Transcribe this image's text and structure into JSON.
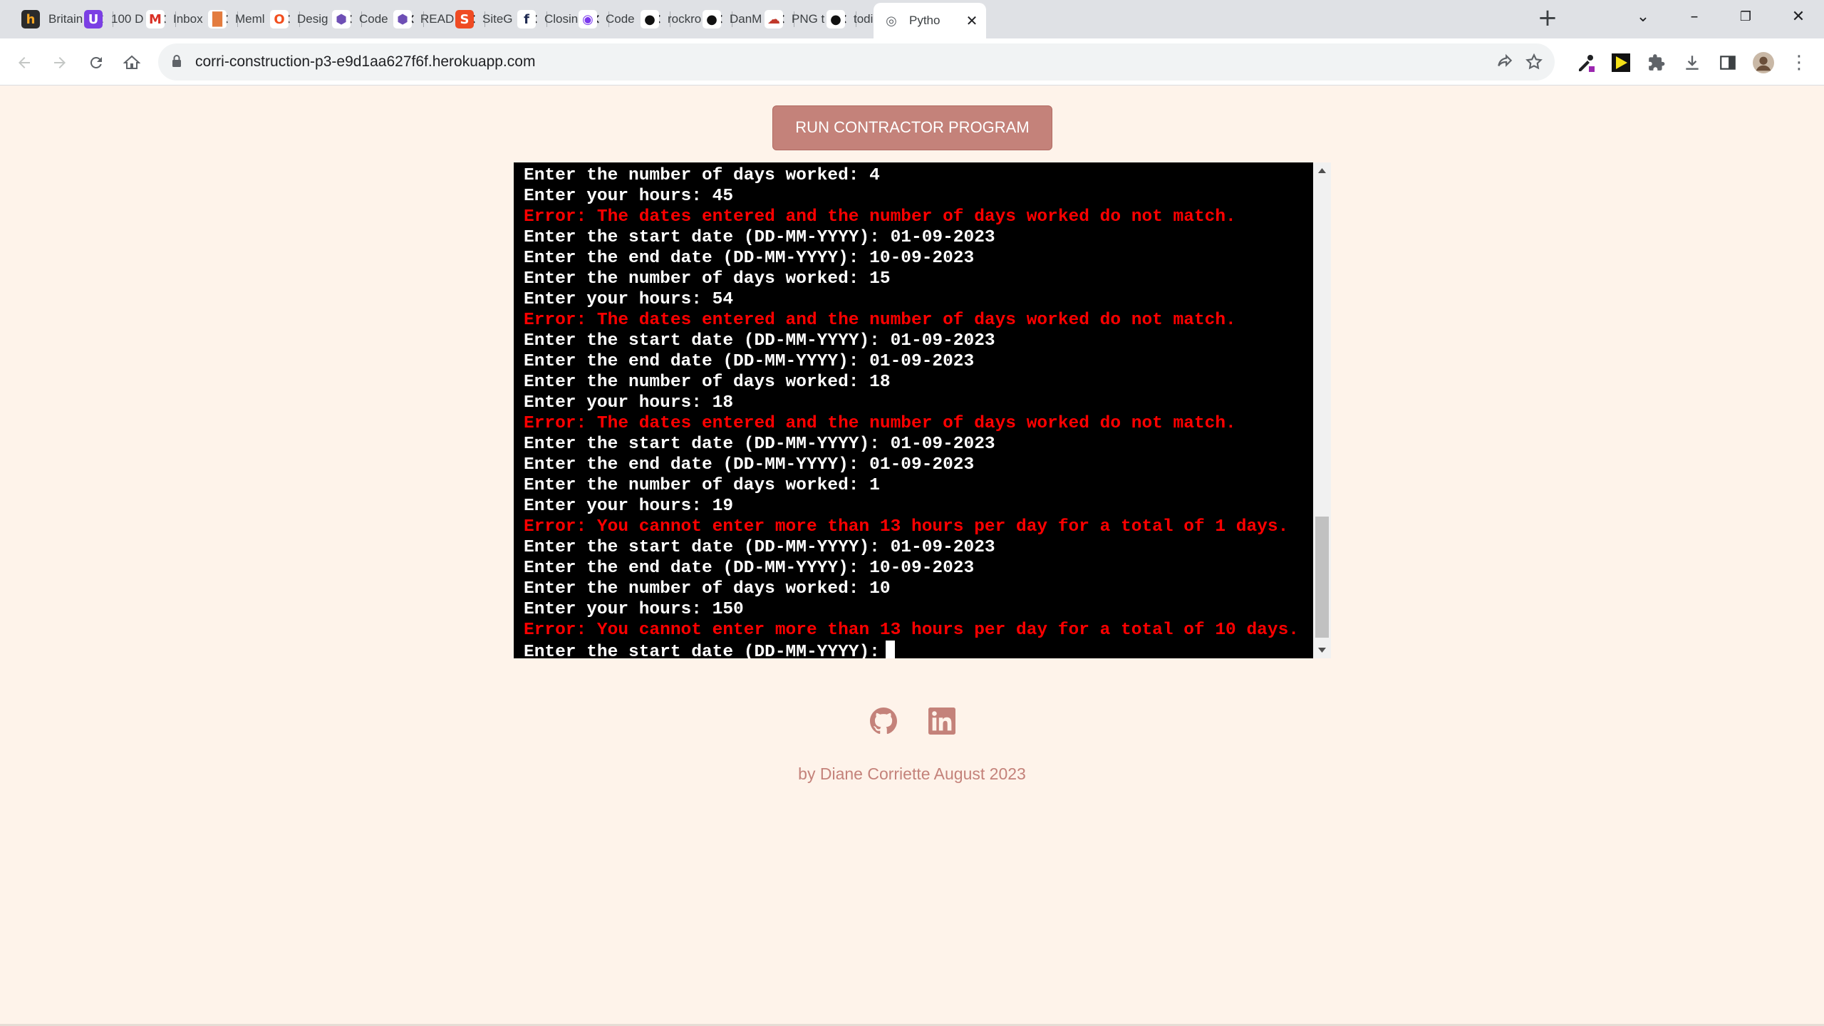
{
  "browser": {
    "tabs": [
      {
        "title": "Britain",
        "icon": "h-icon",
        "fav_char": "h",
        "fav_color": "#2b2b2b",
        "fav_fg": "#f5a623"
      },
      {
        "title": "100 D",
        "icon": "u-icon",
        "fav_char": "U",
        "fav_color": "#7b3fe4",
        "fav_fg": "#ffffff"
      },
      {
        "title": "Inbox",
        "icon": "gmail-icon",
        "fav_char": "M",
        "fav_color": "#ffffff",
        "fav_fg": "#d93025"
      },
      {
        "title": "Meml",
        "icon": "memrise-icon",
        "fav_char": "█",
        "fav_color": "#ffffff",
        "fav_fg": "#e37b3e"
      },
      {
        "title": "Desig",
        "icon": "design-icon",
        "fav_char": "O",
        "fav_color": "#ffffff",
        "fav_fg": "#f24e1e"
      },
      {
        "title": "Code",
        "icon": "codecademy-icon",
        "fav_char": "⬢",
        "fav_color": "#ffffff",
        "fav_fg": "#6e4fb5"
      },
      {
        "title": "READ",
        "icon": "readme-icon",
        "fav_char": "⬢",
        "fav_color": "#ffffff",
        "fav_fg": "#6e4fb5"
      },
      {
        "title": "SiteG",
        "icon": "sitegrade-icon",
        "fav_char": "S",
        "fav_color": "#ef4b23",
        "fav_fg": "#ffffff"
      },
      {
        "title": "Closin",
        "icon": "facebook-icon",
        "fav_char": "f",
        "fav_color": "#ffffff",
        "fav_fg": "#1f2a52"
      },
      {
        "title": "Code",
        "icon": "codepen-icon",
        "fav_char": "◉",
        "fav_color": "#ffffff",
        "fav_fg": "#7c3aed"
      },
      {
        "title": "rockro",
        "icon": "github-icon",
        "fav_char": "●",
        "fav_color": "#ffffff",
        "fav_fg": "#111111"
      },
      {
        "title": "DanM",
        "icon": "github-icon",
        "fav_char": "●",
        "fav_color": "#ffffff",
        "fav_fg": "#111111"
      },
      {
        "title": "PNG t",
        "icon": "png-icon",
        "fav_char": "☁",
        "fav_color": "#ffffff",
        "fav_fg": "#c0392b"
      },
      {
        "title": "todia",
        "icon": "github-icon",
        "fav_char": "●",
        "fav_color": "#ffffff",
        "fav_fg": "#111111"
      },
      {
        "title": "Pytho",
        "icon": "globe-icon",
        "fav_char": "◎",
        "fav_color": "#ffffff",
        "fav_fg": "#5f6368",
        "active": true
      }
    ],
    "url": "corri-construction-p3-e9d1aa627f6f.herokuapp.com"
  },
  "page": {
    "run_button_label": "RUN CONTRACTOR PROGRAM",
    "terminal_lines": [
      {
        "text": "Enter the number of days worked: 4",
        "type": "normal"
      },
      {
        "text": "Enter your hours: 45",
        "type": "normal"
      },
      {
        "text": "Error: The dates entered and the number of days worked do not match.",
        "type": "error"
      },
      {
        "text": "Enter the start date (DD-MM-YYYY): 01-09-2023",
        "type": "normal"
      },
      {
        "text": "Enter the end date (DD-MM-YYYY): 10-09-2023",
        "type": "normal"
      },
      {
        "text": "Enter the number of days worked: 15",
        "type": "normal"
      },
      {
        "text": "Enter your hours: 54",
        "type": "normal"
      },
      {
        "text": "Error: The dates entered and the number of days worked do not match.",
        "type": "error"
      },
      {
        "text": "Enter the start date (DD-MM-YYYY): 01-09-2023",
        "type": "normal"
      },
      {
        "text": "Enter the end date (DD-MM-YYYY): 01-09-2023",
        "type": "normal"
      },
      {
        "text": "Enter the number of days worked: 18",
        "type": "normal"
      },
      {
        "text": "Enter your hours: 18",
        "type": "normal"
      },
      {
        "text": "Error: The dates entered and the number of days worked do not match.",
        "type": "error"
      },
      {
        "text": "Enter the start date (DD-MM-YYYY): 01-09-2023",
        "type": "normal"
      },
      {
        "text": "Enter the end date (DD-MM-YYYY): 01-09-2023",
        "type": "normal"
      },
      {
        "text": "Enter the number of days worked: 1",
        "type": "normal"
      },
      {
        "text": "Enter your hours: 19",
        "type": "normal"
      },
      {
        "text": "Error: You cannot enter more than 13 hours per day for a total of 1 days.",
        "type": "error"
      },
      {
        "text": "Enter the start date (DD-MM-YYYY): 01-09-2023",
        "type": "normal"
      },
      {
        "text": "Enter the end date (DD-MM-YYYY): 10-09-2023",
        "type": "normal"
      },
      {
        "text": "Enter the number of days worked: 10",
        "type": "normal"
      },
      {
        "text": "Enter your hours: 150",
        "type": "normal"
      },
      {
        "text": "Error: You cannot enter more than 13 hours per day for a total of 10 days.",
        "type": "error"
      },
      {
        "text": "Enter the start date (DD-MM-YYYY):",
        "type": "prompt"
      }
    ],
    "social": [
      {
        "name": "github-icon",
        "label": "GitHub"
      },
      {
        "name": "linkedin-icon",
        "label": "LinkedIn"
      }
    ],
    "credit": "by Diane Corriette August 2023"
  },
  "colors": {
    "background": "#fef3ea",
    "accent": "#c4827a",
    "terminal_bg": "#000000",
    "terminal_text": "#ffffff",
    "terminal_error": "#ff0000"
  }
}
